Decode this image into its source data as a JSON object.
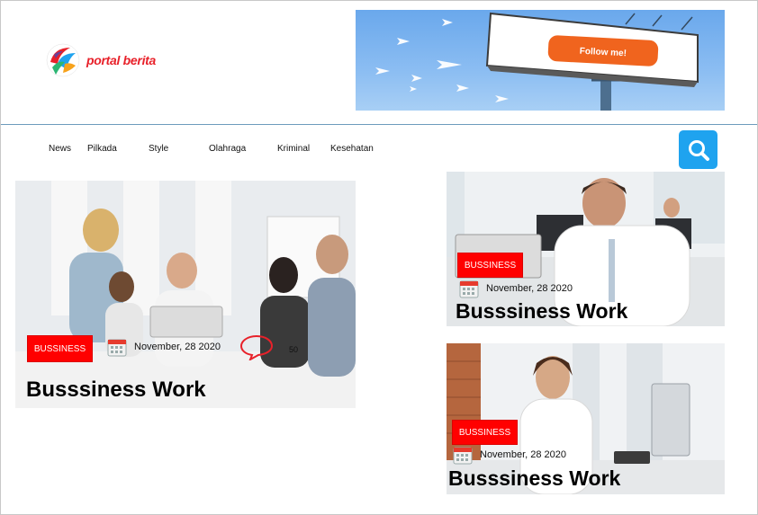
{
  "brand": {
    "name": "portal berita",
    "color": "#e8212a"
  },
  "banner": {
    "billboard_button": "Follow me!",
    "button_color": "#f0641e"
  },
  "nav": {
    "items": [
      {
        "label": "News"
      },
      {
        "label": "Pilkada"
      },
      {
        "label": "Style"
      },
      {
        "label": "Olahraga"
      },
      {
        "label": "Kriminal"
      },
      {
        "label": "Kesehatan"
      }
    ]
  },
  "search": {
    "icon": "search-icon",
    "color": "#1fa3ef"
  },
  "articles": [
    {
      "category": "BUSSINESS",
      "date": "November, 28 2020",
      "title": "Busssiness Work",
      "comments": "50"
    },
    {
      "category": "BUSSINESS",
      "date": "November, 28 2020",
      "title": "Busssiness Work"
    },
    {
      "category": "BUSSINESS",
      "date": "November, 28 2020",
      "title": "Busssiness Work"
    }
  ],
  "colors": {
    "badge": "#ff0000",
    "divider": "#6d9bbd"
  }
}
